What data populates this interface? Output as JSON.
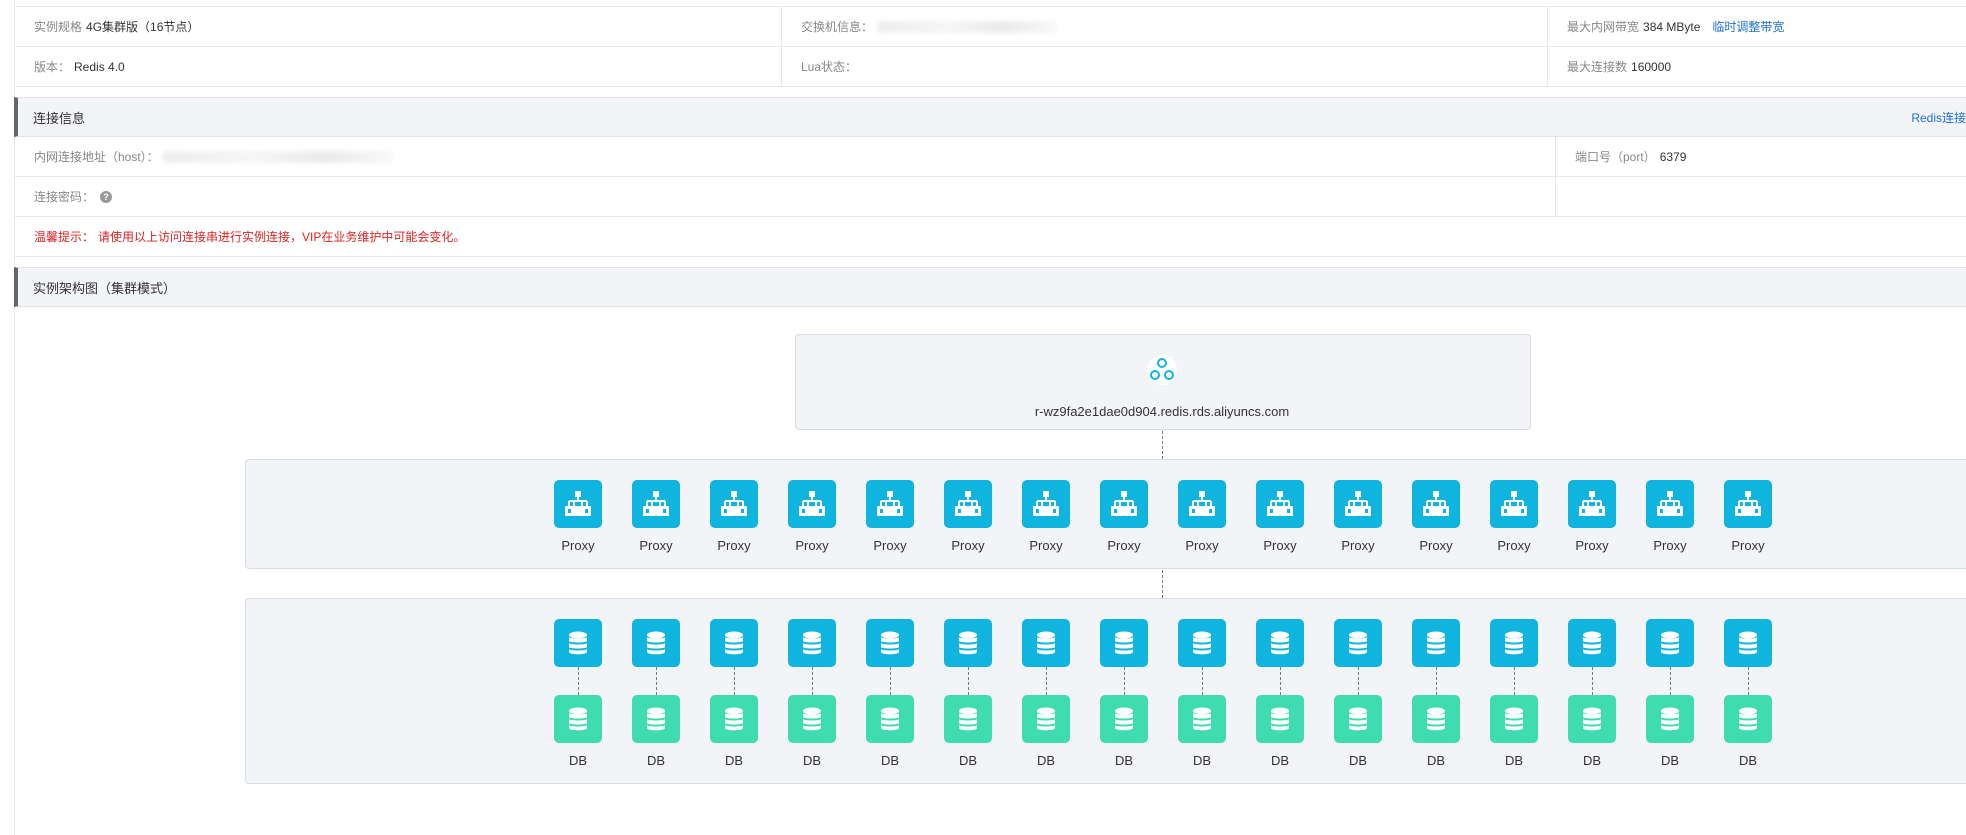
{
  "info": {
    "spec_label": "实例规格",
    "spec_value": "4G集群版（16节点）",
    "switch_label": "交换机信息：",
    "bandwidth_label": "最大内网带宽",
    "bandwidth_value": "384 MByte",
    "bandwidth_link": "临时调整带宽",
    "version_label": "版本：",
    "version_value": "Redis 4.0",
    "lua_label": "Lua状态：",
    "conn_label": "最大连接数",
    "conn_value": "160000"
  },
  "connection": {
    "title": "连接信息",
    "link": "Redis连接",
    "host_label": "内网连接地址（host）：",
    "port_label": "端口号（port）",
    "port_value": "6379",
    "password_label": "连接密码：",
    "help_icon": "?",
    "tip_label": "温馨提示：",
    "tip_text": "请使用以上访问连接串进行实例连接，VIP在业务维护中可能会变化。"
  },
  "architecture": {
    "title": "实例架构图（集群模式）",
    "host": "r-wz9fa2e1dae0d904.redis.rds.aliyuncs.com",
    "proxy_label": "Proxy",
    "db_label": "DB",
    "proxy_count": 16,
    "db_count": 16
  },
  "colors": {
    "primary_node": "#0fb5df",
    "replica_node": "#3fdcb0",
    "link": "#1b6fd6",
    "warning": "#e02222"
  }
}
